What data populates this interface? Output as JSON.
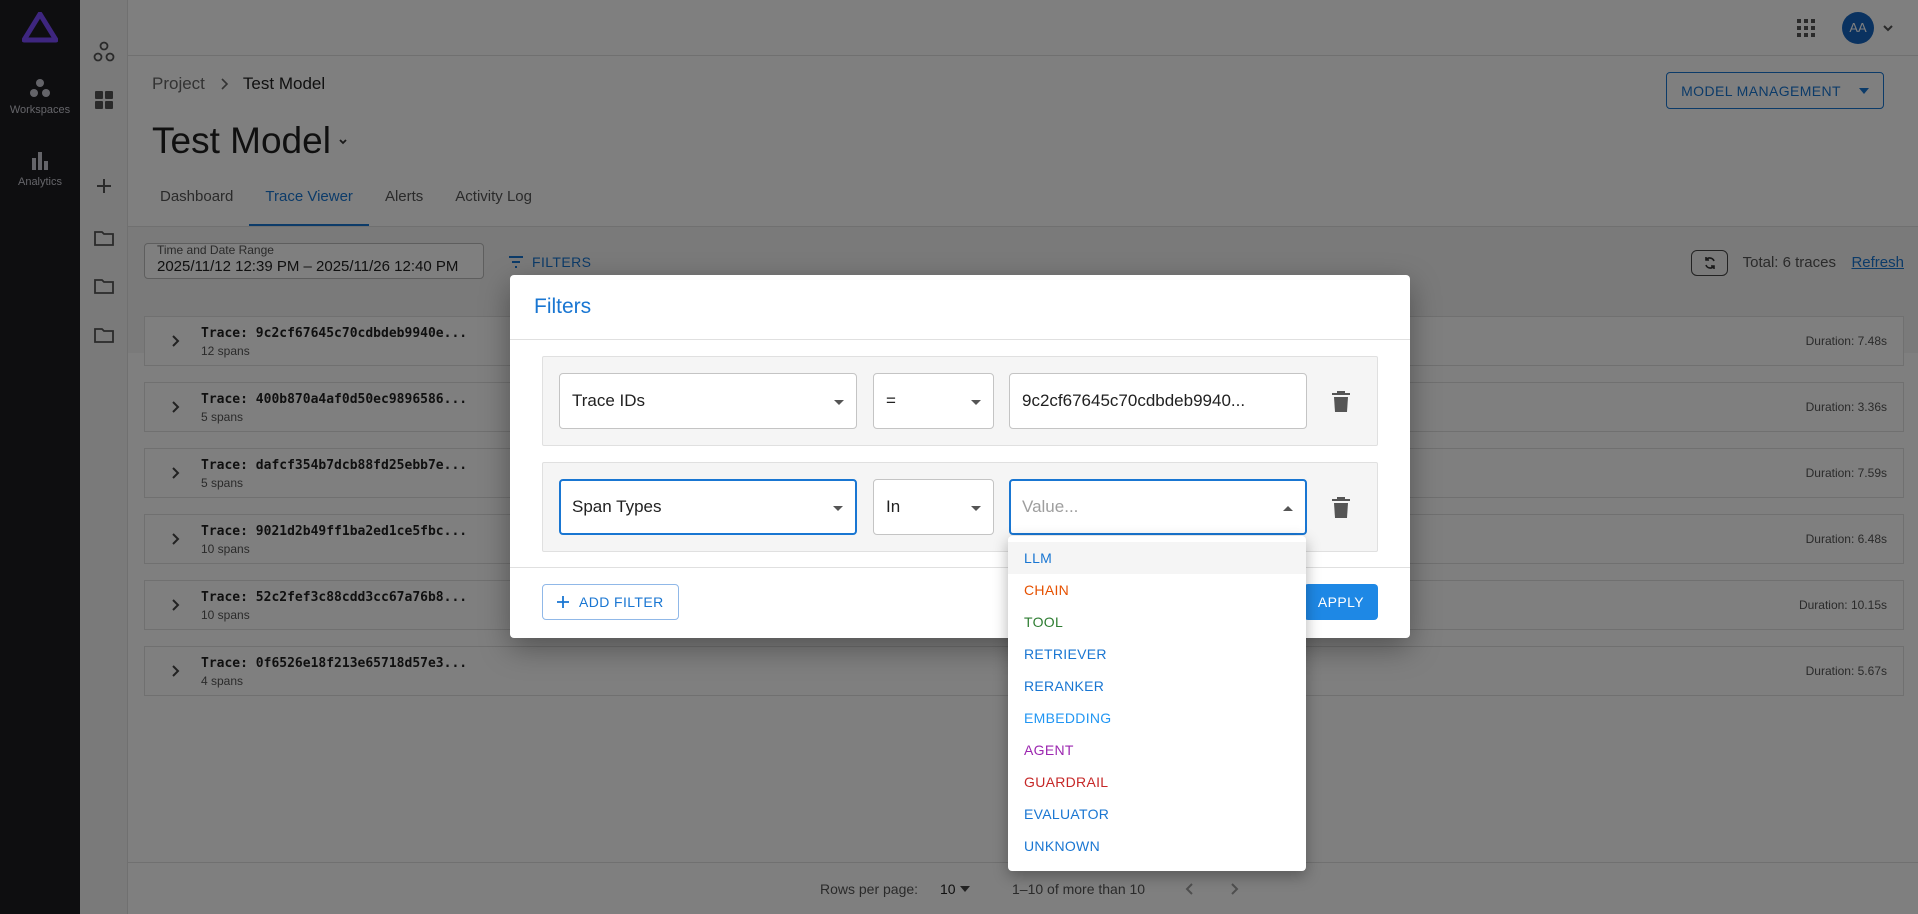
{
  "nav": {
    "items": [
      {
        "label": "Workspaces",
        "icon": "workspaces-icon"
      },
      {
        "label": "Analytics",
        "icon": "analytics-icon"
      }
    ]
  },
  "topbar": {
    "avatar_initials": "AA"
  },
  "breadcrumb": {
    "root": "Project",
    "current": "Test Model"
  },
  "page": {
    "title": "Test Model",
    "model_management_label": "MODEL MANAGEMENT",
    "tabs": [
      {
        "label": "Dashboard",
        "active": false
      },
      {
        "label": "Trace Viewer",
        "active": true
      },
      {
        "label": "Alerts",
        "active": false
      },
      {
        "label": "Activity Log",
        "active": false
      }
    ]
  },
  "toolbar": {
    "date_label": "Time and Date Range",
    "date_value": "2025/11/12 12:39 PM – 2025/11/26 12:40 PM",
    "filters_label": "FILTERS",
    "total": "Total: 6 traces",
    "refresh": "Refresh"
  },
  "traces": [
    {
      "id": "Trace: 9c2cf67645c70cdbdeb9940e...",
      "spans": "12 spans",
      "duration": "Duration: 7.48s"
    },
    {
      "id": "Trace: 400b870a4af0d50ec9896586...",
      "spans": "5 spans",
      "duration": "Duration: 3.36s"
    },
    {
      "id": "Trace: dafcf354b7dcb88fd25ebb7e...",
      "spans": "5 spans",
      "duration": "Duration: 7.59s"
    },
    {
      "id": "Trace: 9021d2b49ff1ba2ed1ce5fbc...",
      "spans": "10 spans",
      "duration": "Duration: 6.48s"
    },
    {
      "id": "Trace: 52c2fef3c88cdd3cc67a76b8...",
      "spans": "10 spans",
      "duration": "Duration: 10.15s"
    },
    {
      "id": "Trace: 0f6526e18f213e65718d57e3...",
      "spans": "4 spans",
      "duration": "Duration: 5.67s"
    }
  ],
  "pagination": {
    "rows_label": "Rows per page:",
    "rows_value": "10",
    "range": "1–10 of more than 10"
  },
  "dialog": {
    "title": "Filters",
    "filters": [
      {
        "field": "Trace IDs",
        "operator": "=",
        "value": "9c2cf67645c70cdbdeb9940..."
      },
      {
        "field": "Span Types",
        "operator": "In",
        "value_placeholder": "Value..."
      }
    ],
    "add_filter_label": "ADD FILTER",
    "apply_label": "APPLY"
  },
  "span_type_options": [
    {
      "label": "LLM",
      "color": "#1976d2",
      "highlighted": true
    },
    {
      "label": "CHAIN",
      "color": "#e65100"
    },
    {
      "label": "TOOL",
      "color": "#2e7d32"
    },
    {
      "label": "RETRIEVER",
      "color": "#1976d2"
    },
    {
      "label": "RERANKER",
      "color": "#1976d2"
    },
    {
      "label": "EMBEDDING",
      "color": "#2196f3"
    },
    {
      "label": "AGENT",
      "color": "#9c27b0"
    },
    {
      "label": "GUARDRAIL",
      "color": "#c62828"
    },
    {
      "label": "EVALUATOR",
      "color": "#1976d2"
    },
    {
      "label": "UNKNOWN",
      "color": "#1976d2"
    }
  ]
}
